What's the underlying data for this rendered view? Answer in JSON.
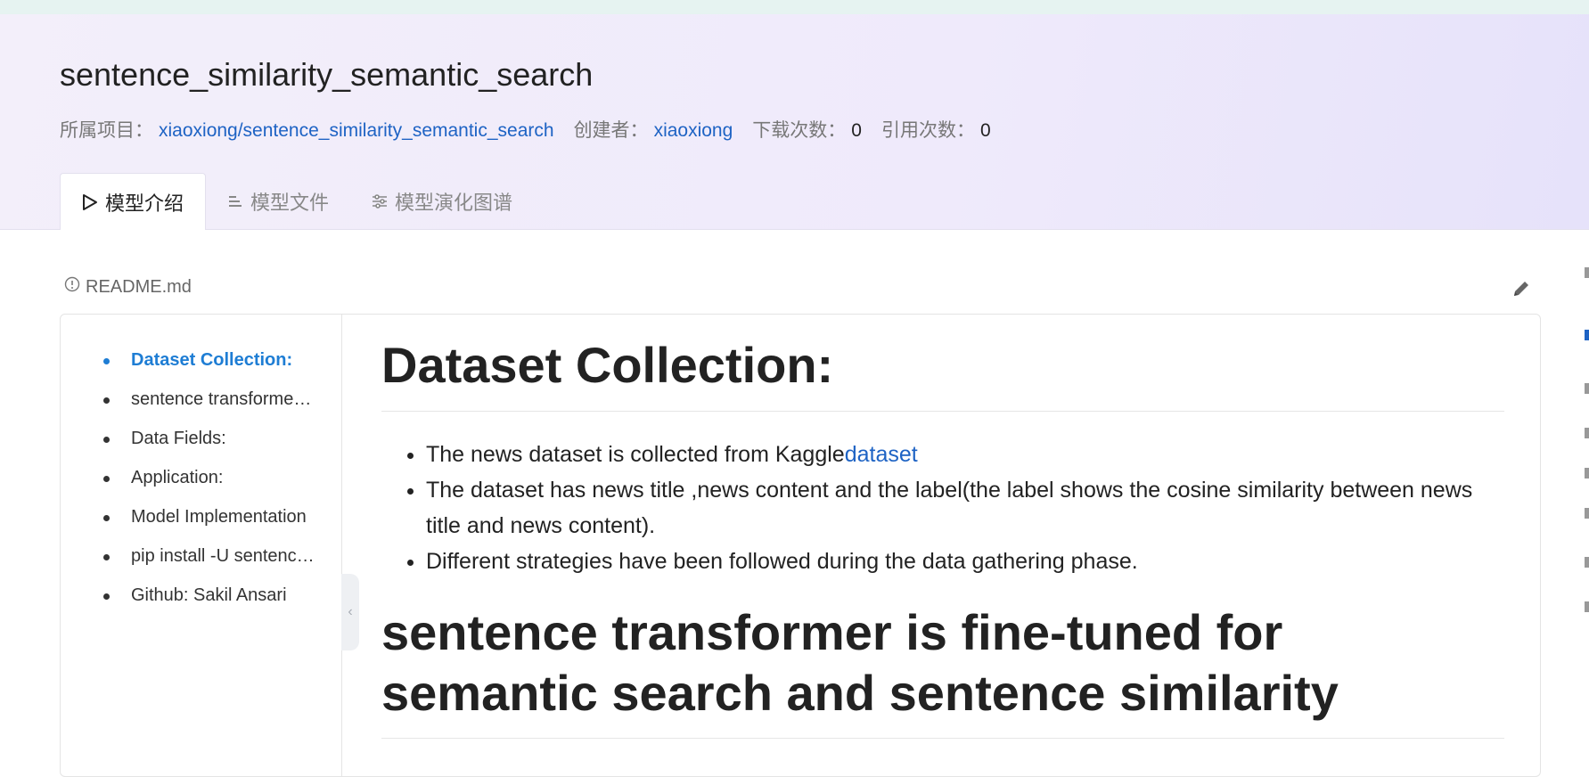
{
  "header": {
    "title": "sentence_similarity_semantic_search",
    "project_label": "所属项目：",
    "project_link": "xiaoxiong/sentence_similarity_semantic_search",
    "creator_label": "创建者：",
    "creator_link": "xiaoxiong",
    "downloads_label": "下载次数：",
    "downloads_value": "0",
    "citations_label": "引用次数：",
    "citations_value": "0"
  },
  "tabs": [
    {
      "label": "模型介绍",
      "icon": "play-outline-icon",
      "active": true
    },
    {
      "label": "模型文件",
      "icon": "file-lines-icon",
      "active": false
    },
    {
      "label": "模型演化图谱",
      "icon": "sliders-icon",
      "active": false
    }
  ],
  "readme": {
    "filename": "README.md",
    "icon": "info-circle-icon",
    "edit_icon": "pencil-icon"
  },
  "toc": {
    "items": [
      {
        "label": "Dataset Collection:",
        "active": true
      },
      {
        "label": "sentence transformer is fine-tuned for semantic search and sentence similarity",
        "active": false
      },
      {
        "label": "Data Fields:",
        "active": false
      },
      {
        "label": "Application:",
        "active": false
      },
      {
        "label": "Model Implementation",
        "active": false
      },
      {
        "label": "pip install -U sentence-transformers",
        "active": false
      },
      {
        "label": "Github: Sakil Ansari",
        "active": false
      }
    ],
    "collapse_icon": "chevron-left-icon"
  },
  "content": {
    "h1": "Dataset Collection:",
    "bullets": [
      {
        "text": "The news dataset is collected from Kaggle",
        "link": "dataset"
      },
      {
        "text": "The dataset has news title ,news content and the label(the label shows the cosine similarity between news title and news content).",
        "link": ""
      },
      {
        "text": "Different strategies have been followed during the data gathering phase.",
        "link": ""
      }
    ],
    "h2": "sentence transformer is fine-tuned for semantic search and sentence similarity"
  },
  "colors": {
    "link": "#1e63c4",
    "toc_active": "#1e7dd4",
    "header_bg": "#f1edfa"
  }
}
